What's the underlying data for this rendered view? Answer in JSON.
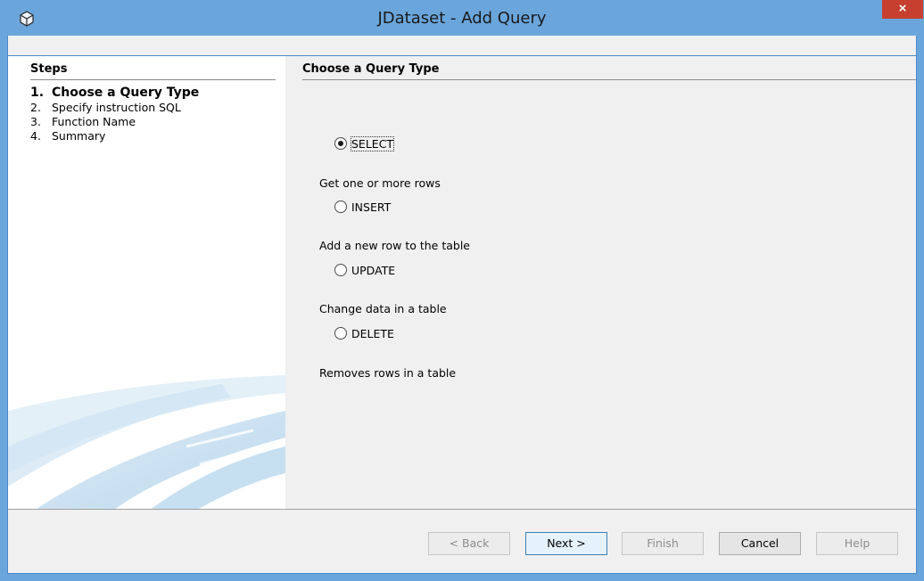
{
  "window": {
    "title": "JDataset - Add Query",
    "close_label": "×"
  },
  "steps": {
    "heading": "Steps",
    "items": [
      {
        "num": "1.",
        "label": "Choose a Query Type",
        "active": true
      },
      {
        "num": "2.",
        "label": "Specify instruction SQL",
        "active": false
      },
      {
        "num": "3.",
        "label": "Function Name",
        "active": false
      },
      {
        "num": "4.",
        "label": "Summary",
        "active": false
      }
    ]
  },
  "content": {
    "heading": "Choose a Query Type",
    "options": [
      {
        "label": "SELECT",
        "description": "Get one or more rows",
        "selected": true
      },
      {
        "label": "INSERT",
        "description": "Add a new row to the table",
        "selected": false
      },
      {
        "label": "UPDATE",
        "description": "Change data in a table",
        "selected": false
      },
      {
        "label": "DELETE",
        "description": "Removes rows in a table",
        "selected": false
      }
    ]
  },
  "buttons": {
    "back": "< Back",
    "next": "Next >",
    "finish": "Finish",
    "cancel": "Cancel",
    "help": "Help"
  },
  "colors": {
    "titlebar": "#6aa6dc",
    "close": "#c7402f",
    "panel": "#f0f0f0"
  },
  "icons": {
    "app": "cube-icon",
    "close": "close-icon"
  }
}
